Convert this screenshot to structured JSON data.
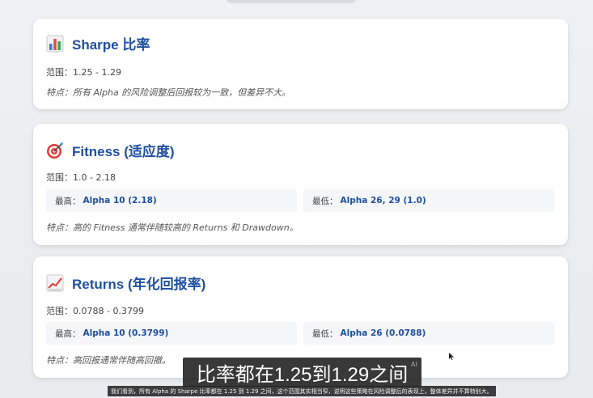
{
  "cards": [
    {
      "title": "Sharpe 比率",
      "icon": "bar-chart-icon",
      "range": "范围：1.25 - 1.29",
      "note": "特点：所有 Alpha 的风险调整后回报较为一致，但差异不大。"
    },
    {
      "title": "Fitness (适应度)",
      "icon": "target-dart-icon",
      "range": "范围：1.0 - 2.18",
      "high_label": "最高：",
      "high_value": "Alpha 10 (2.18)",
      "low_label": "最低：",
      "low_value": "Alpha 26, 29 (1.0)",
      "note": "特点：高的 Fitness 通常伴随较高的 Returns 和 Drawdown。"
    },
    {
      "title": "Returns (年化回报率)",
      "icon": "line-chart-up-icon",
      "range": "范围：0.0788 - 0.3799",
      "high_label": "最高：",
      "high_value": "Alpha 10 (0.3799)",
      "low_label": "最低：",
      "low_value": "Alpha 26 (0.0788)",
      "note": "特点：高回报通常伴随高回撤。"
    }
  ],
  "subtitle": {
    "main": "比率都在1.25到1.29之间",
    "ai_tag": "AI",
    "small": "我们看到，所有 Alpha 的 Sharpe 比率都在 1.25 到 1.29 之间，这个范围其实相当窄，说明这些策略在风险调整后的表现上，整体差异并不算特别大。"
  },
  "colors": {
    "title": "#1f4fa0",
    "card_bg": "#ffffff",
    "stat_bg": "#f4f6f8"
  }
}
